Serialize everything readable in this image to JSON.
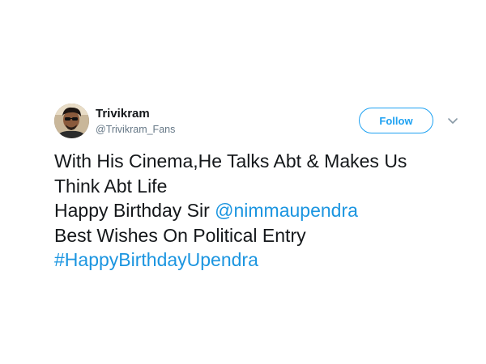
{
  "author": {
    "display_name": "Trivikram",
    "screen_name": "@Trivikram_Fans",
    "avatar_icon": "user-avatar-photo"
  },
  "actions": {
    "follow_label": "Follow",
    "more_icon": "chevron-down-icon"
  },
  "tweet": {
    "line1": "With His Cinema,He Talks Abt & Makes Us",
    "line2": "Think Abt Life",
    "line3_text": "Happy Birthday Sir ",
    "line3_mention": "@nimmaupendra",
    "line4": "Best Wishes On Political Entry",
    "line5_hashtag": "#HappyBirthdayUpendra"
  },
  "colors": {
    "accent": "#1da1f2",
    "link": "#1b95e0",
    "text": "#14171a",
    "secondary_text": "#657786"
  }
}
